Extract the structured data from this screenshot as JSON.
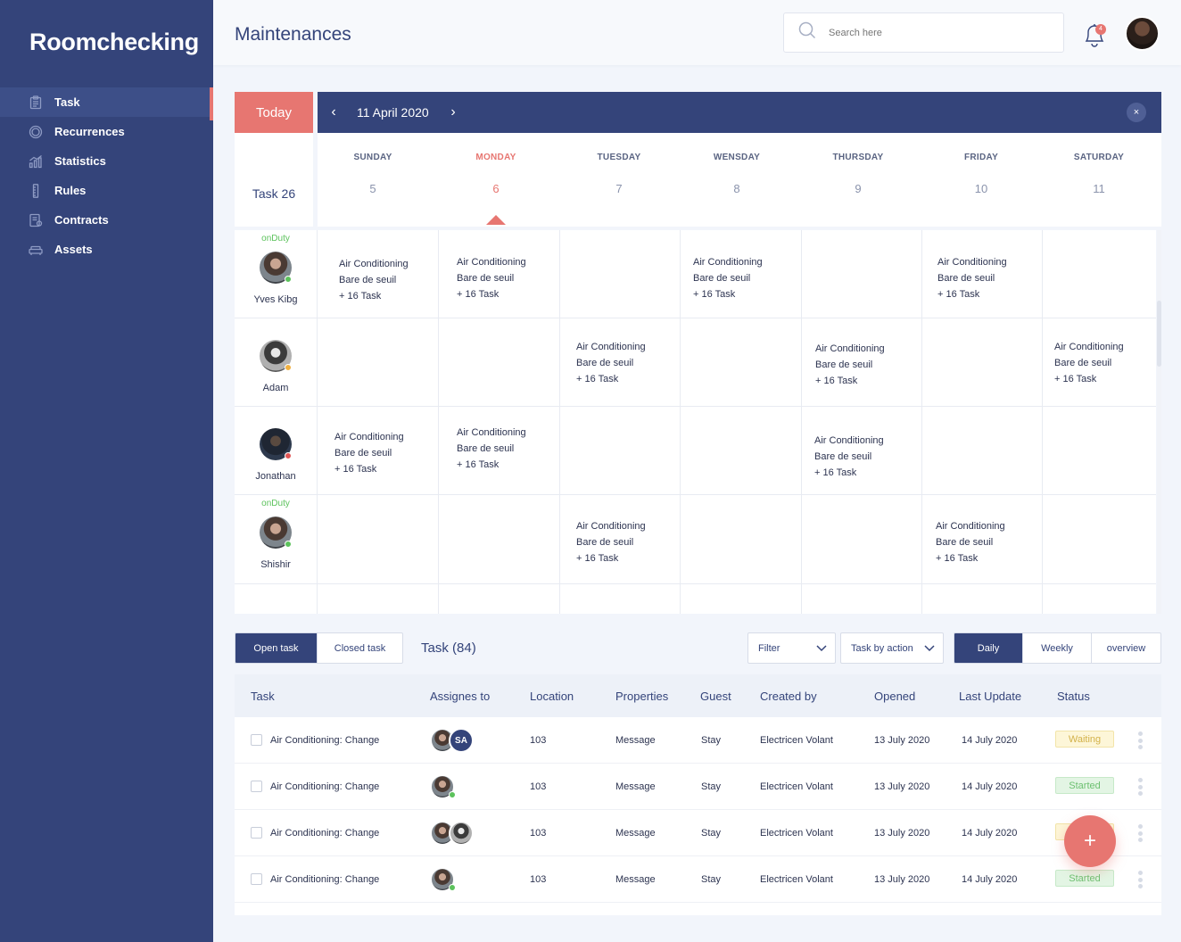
{
  "app": {
    "brand": "Roomchecking",
    "page_title": "Maintenances"
  },
  "sidebar": {
    "items": [
      {
        "label": "Task",
        "icon": "clipboard-icon",
        "active": true
      },
      {
        "label": "Recurrences",
        "icon": "recurrence-icon",
        "active": false
      },
      {
        "label": "Statistics",
        "icon": "chart-icon",
        "active": false
      },
      {
        "label": "Rules",
        "icon": "ruler-icon",
        "active": false
      },
      {
        "label": "Contracts",
        "icon": "contract-icon",
        "active": false
      },
      {
        "label": "Assets",
        "icon": "sofa-icon",
        "active": false
      }
    ]
  },
  "header": {
    "search_placeholder": "Search here",
    "notification_count": "4"
  },
  "calendar": {
    "today_label": "Today",
    "date_label": "11 April 2020",
    "task_count_label": "Task 26",
    "close_label": "×",
    "days": [
      {
        "name": "SUNDAY",
        "num": "5",
        "active": false
      },
      {
        "name": "MONDAY",
        "num": "6",
        "active": true
      },
      {
        "name": "TUESDAY",
        "num": "7",
        "active": false
      },
      {
        "name": "WENSDAY",
        "num": "8",
        "active": false
      },
      {
        "name": "THURSDAY",
        "num": "9",
        "active": false
      },
      {
        "name": "FRIDAY",
        "num": "10",
        "active": false
      },
      {
        "name": "SATURDAY",
        "num": "11",
        "active": false
      }
    ],
    "people": [
      {
        "name": "Yves Kibg",
        "on_duty": "onDuty",
        "status_color": "#5cc25c"
      },
      {
        "name": "Adam",
        "on_duty": "",
        "status_color": "#f0b040"
      },
      {
        "name": "Jonathan",
        "on_duty": "",
        "status_color": "#e15555"
      },
      {
        "name": "Shishir",
        "on_duty": "onDuty",
        "status_color": "#5cc25c"
      }
    ],
    "task_card": {
      "line1": "Air Conditioning",
      "line2": "Bare de seuil",
      "line3": "+ 16 Task"
    }
  },
  "tasks": {
    "tab_open": "Open task",
    "tab_closed": "Closed task",
    "heading": "Task (84)",
    "filter_label": "Filter",
    "task_by_action_label": "Task by action",
    "view_daily": "Daily",
    "view_weekly": "Weekly",
    "view_overview": "overview",
    "columns": [
      "Task",
      "Assignes to",
      "Location",
      "Properties",
      "Guest",
      "Created by",
      "Opened",
      "Last Update",
      "Status"
    ],
    "rows": [
      {
        "task": "Air Conditioning: Change",
        "assignee_initials": "SA",
        "location": "103",
        "properties": "Message",
        "guest": "Stay",
        "created_by": "Electricen Volant",
        "opened": "13 July 2020",
        "last_update": "14 July 2020",
        "status": "Waiting"
      },
      {
        "task": "Air Conditioning: Change",
        "assignee_initials": "",
        "location": "103",
        "properties": "Message",
        "guest": "Stay",
        "created_by": "Electricen Volant",
        "opened": "13 July 2020",
        "last_update": "14 July 2020",
        "status": "Started"
      },
      {
        "task": "Air Conditioning: Change",
        "assignee_initials": "",
        "location": "103",
        "properties": "Message",
        "guest": "Stay",
        "created_by": "Electricen Volant",
        "opened": "13 July 2020",
        "last_update": "14 July 2020",
        "status": ""
      },
      {
        "task": "Air Conditioning: Change",
        "assignee_initials": "",
        "location": "103",
        "properties": "Message",
        "guest": "Stay",
        "created_by": "Electricen Volant",
        "opened": "13 July 2020",
        "last_update": "14 July 2020",
        "status": "Started"
      }
    ]
  },
  "fab_label": "+",
  "colors": {
    "primary": "#34447a",
    "accent": "#e77671",
    "success": "#5cc25c",
    "warning": "#d3b24a"
  }
}
